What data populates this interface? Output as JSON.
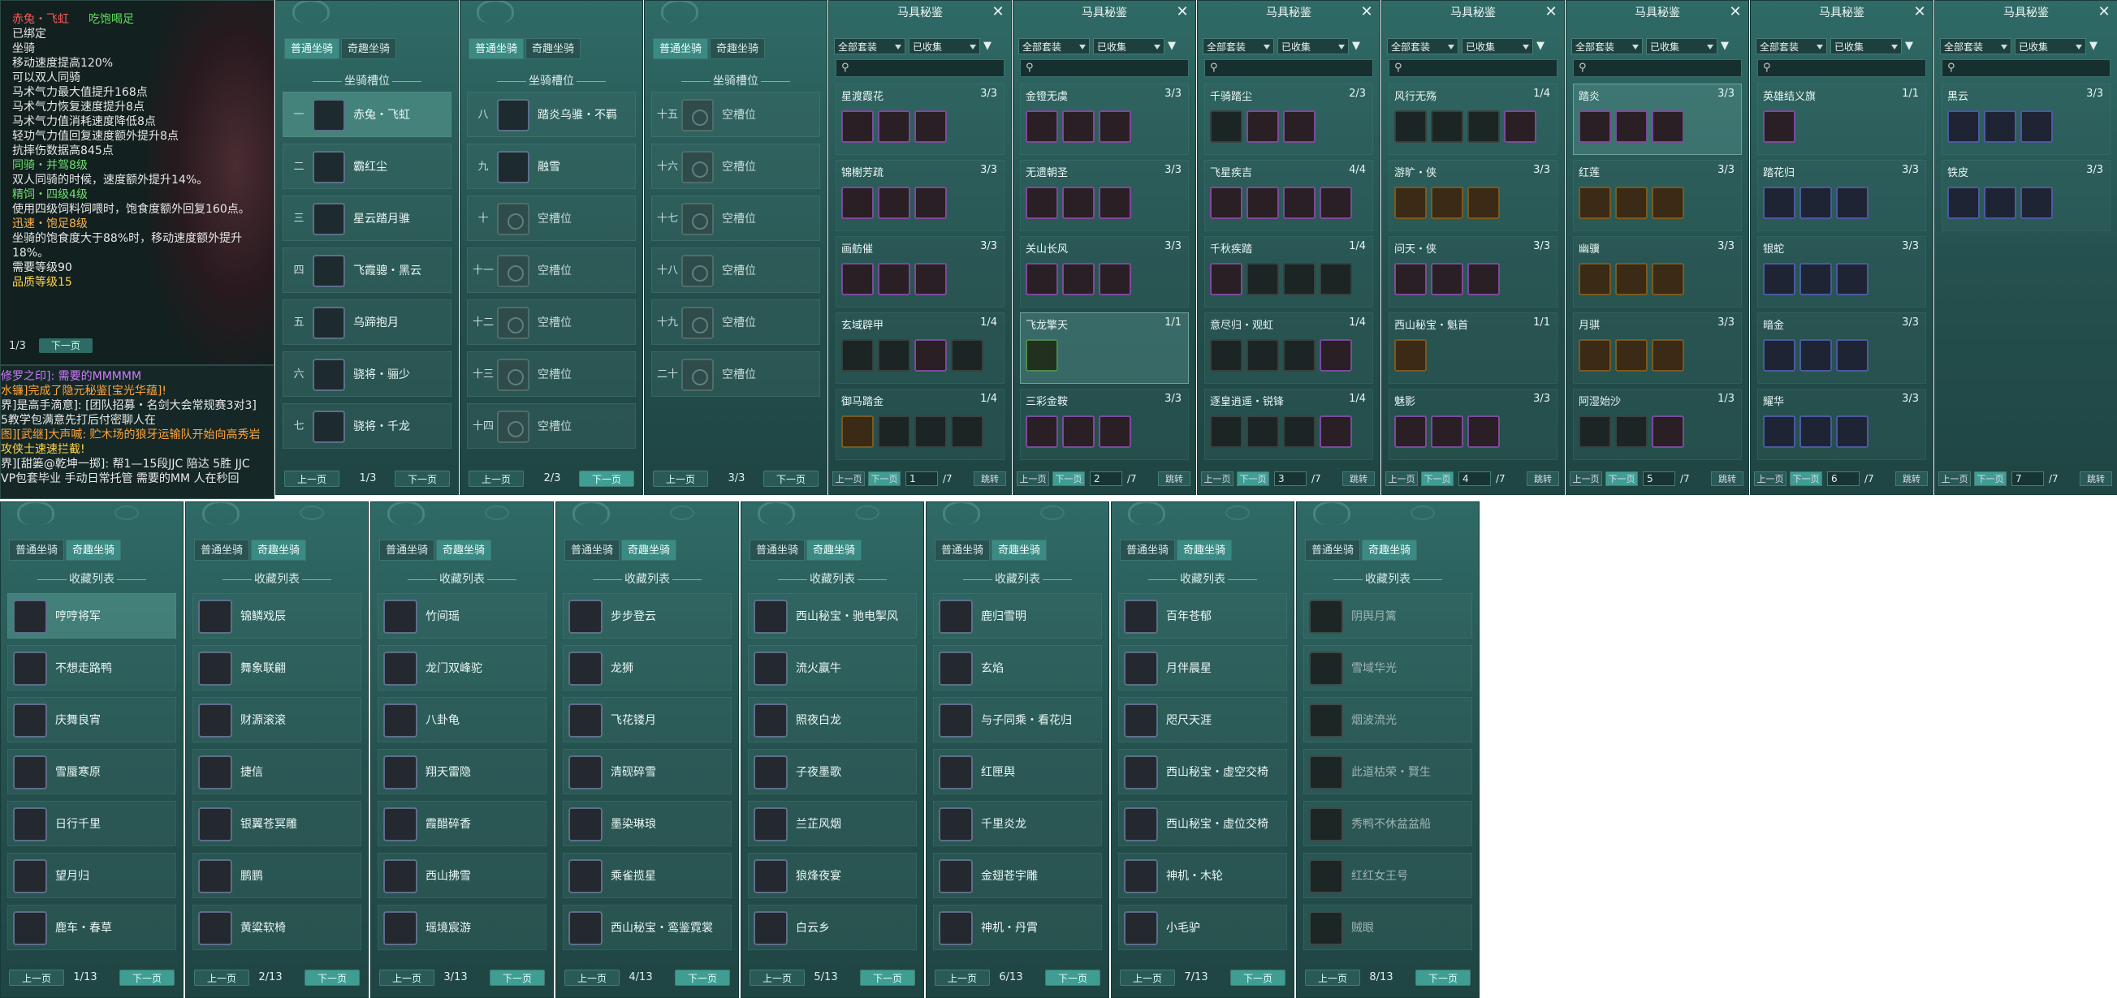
{
  "tooltip": {
    "name": "赤兔・飞虹",
    "status_tag": "吃饱喝足",
    "lines": [
      {
        "t": "已绑定",
        "c": ""
      },
      {
        "t": "坐骑",
        "c": ""
      },
      {
        "t": "移动速度提高120%",
        "c": ""
      },
      {
        "t": "可以双人同骑",
        "c": ""
      },
      {
        "t": "马术气力最大值提升168点",
        "c": ""
      },
      {
        "t": "马术气力恢复速度提升8点",
        "c": ""
      },
      {
        "t": "马术气力值消耗速度降低8点",
        "c": ""
      },
      {
        "t": "轻功气力值回复速度额外提升8点",
        "c": ""
      },
      {
        "t": "抗摔伤数据高845点",
        "c": ""
      },
      {
        "t": "同骑・并驾8级",
        "c": "skill"
      },
      {
        "t": "双人同骑的时候，速度额外提升14%。",
        "c": "desc"
      },
      {
        "t": "精饲・四级4级",
        "c": "skill"
      },
      {
        "t": "使用四级饲料饲喂时，饱食度额外回复160点。",
        "c": "desc"
      },
      {
        "t": "迅速・饱足8级",
        "c": "skill2"
      },
      {
        "t": "坐骑的饱食度大于88%时，移动速度额外提升18%。",
        "c": "desc"
      },
      {
        "t": "需要等级90",
        "c": ""
      },
      {
        "t": "品质等级15",
        "c": "q"
      }
    ],
    "page": "1/3",
    "next": "下一页"
  },
  "chat": [
    {
      "t": "修罗之印]: 需要的MMMMM",
      "c": "c-purple"
    },
    {
      "t": "水镰]完成了隐元秘鉴[宝光华蕴]!",
      "c": "c-orange"
    },
    {
      "t": "界]是高手滴意]: [团队招募・名剑大会常规赛3对3]",
      "c": "c-white"
    },
    {
      "t": "5教学包满意先打后付密聊人在",
      "c": "c-white"
    },
    {
      "t": "图][武继]大声喊: 贮木场的狼牙运输队开始向高秀岩",
      "c": "c-orange"
    },
    {
      "t": "攻侠士速速拦截!",
      "c": "c-yellow"
    },
    {
      "t": "界][甜篓@乾坤一掷]: 帮1—15段JJC 陪达 5胜 JJC",
      "c": "c-white"
    },
    {
      "t": "VP包套毕业 手动日常托管 需要的MM 人在秒回",
      "c": "c-white"
    }
  ],
  "seat_tabs": [
    "普通坐骑",
    "奇趣坐骑"
  ],
  "seat_section": "坐骑槽位",
  "seat_panels": [
    {
      "page": "1/3",
      "rows": [
        {
          "n": "一",
          "name": "赤兔・飞虹",
          "empty": false,
          "sel": true
        },
        {
          "n": "二",
          "name": "霸红尘",
          "empty": false
        },
        {
          "n": "三",
          "name": "星云踏月骓",
          "empty": false
        },
        {
          "n": "四",
          "name": "飞霞骢・黑云",
          "empty": false
        },
        {
          "n": "五",
          "name": "乌蹄抱月",
          "empty": false
        },
        {
          "n": "六",
          "name": "骁将・骊少",
          "empty": false
        },
        {
          "n": "七",
          "name": "骁将・千龙",
          "empty": false
        }
      ]
    },
    {
      "page": "2/3",
      "rows": [
        {
          "n": "八",
          "name": "踏炎乌骓・不羁",
          "empty": false
        },
        {
          "n": "九",
          "name": "融雪",
          "empty": false
        },
        {
          "n": "十",
          "name": "空槽位",
          "empty": true
        },
        {
          "n": "十一",
          "name": "空槽位",
          "empty": true
        },
        {
          "n": "十二",
          "name": "空槽位",
          "empty": true
        },
        {
          "n": "十三",
          "name": "空槽位",
          "empty": true
        },
        {
          "n": "十四",
          "name": "空槽位",
          "empty": true
        }
      ]
    },
    {
      "page": "3/3",
      "rows": [
        {
          "n": "十五",
          "name": "空槽位",
          "empty": true
        },
        {
          "n": "十六",
          "name": "空槽位",
          "empty": true
        },
        {
          "n": "十七",
          "name": "空槽位",
          "empty": true
        },
        {
          "n": "十八",
          "name": "空槽位",
          "empty": true
        },
        {
          "n": "十九",
          "name": "空槽位",
          "empty": true
        },
        {
          "n": "二十",
          "name": "空槽位",
          "empty": true
        }
      ]
    }
  ],
  "prev": "上一页",
  "next": "下一页",
  "saddle_title": "马具秘鉴",
  "saddle_filter1": "全部套装",
  "saddle_filter2": "已收集",
  "saddle_jump": "跳转",
  "saddle_total": "/7",
  "saddle_panels": [
    {
      "page": "1",
      "groups": [
        {
          "name": "星渡霞花",
          "cnt": "3/3",
          "icons": [
            "p",
            "p",
            "p"
          ]
        },
        {
          "name": "锦榭芳疏",
          "cnt": "3/3",
          "icons": [
            "p",
            "p",
            "p"
          ]
        },
        {
          "name": "画舫催",
          "cnt": "3/3",
          "icons": [
            "p",
            "p",
            "p"
          ]
        },
        {
          "name": "玄域辟甲",
          "cnt": "1/4",
          "icons": [
            "d",
            "d",
            "p",
            "d"
          ]
        },
        {
          "name": "御马踏金",
          "cnt": "1/4",
          "icons": [
            "g",
            "d",
            "d",
            "d"
          ]
        }
      ]
    },
    {
      "page": "2",
      "groups": [
        {
          "name": "金镫无虞",
          "cnt": "3/3",
          "icons": [
            "p",
            "p",
            "p"
          ]
        },
        {
          "name": "无遗朝圣",
          "cnt": "3/3",
          "icons": [
            "p",
            "p",
            "p"
          ]
        },
        {
          "name": "关山长风",
          "cnt": "3/3",
          "icons": [
            "p",
            "p",
            "p"
          ]
        },
        {
          "name": "飞龙擎天",
          "cnt": "1/1",
          "icons": [
            "gr"
          ],
          "sel": true
        },
        {
          "name": "三彩金鞍",
          "cnt": "3/3",
          "icons": [
            "p",
            "p",
            "p"
          ]
        }
      ]
    },
    {
      "page": "3",
      "groups": [
        {
          "name": "千骑踏尘",
          "cnt": "2/3",
          "icons": [
            "d",
            "p",
            "p"
          ]
        },
        {
          "name": "飞星疾吉",
          "cnt": "4/4",
          "icons": [
            "p",
            "p",
            "p",
            "p"
          ]
        },
        {
          "name": "千秋疾踏",
          "cnt": "1/4",
          "icons": [
            "p",
            "d",
            "d",
            "d"
          ]
        },
        {
          "name": "意尽归・观虹",
          "cnt": "1/4",
          "icons": [
            "d",
            "d",
            "d",
            "p"
          ]
        },
        {
          "name": "逐皇逍遥・锐锋",
          "cnt": "1/4",
          "icons": [
            "d",
            "d",
            "d",
            "p"
          ]
        }
      ]
    },
    {
      "page": "4",
      "groups": [
        {
          "name": "风行无殇",
          "cnt": "1/4",
          "icons": [
            "d",
            "d",
            "d",
            "p"
          ]
        },
        {
          "name": "游旷・侠",
          "cnt": "3/3",
          "icons": [
            "g",
            "g",
            "g"
          ]
        },
        {
          "name": "问天・侠",
          "cnt": "3/3",
          "icons": [
            "p",
            "p",
            "p"
          ]
        },
        {
          "name": "西山秘宝・魁首",
          "cnt": "1/1",
          "icons": [
            "g"
          ]
        },
        {
          "name": "魅影",
          "cnt": "3/3",
          "icons": [
            "p",
            "p",
            "p"
          ]
        }
      ]
    },
    {
      "page": "5",
      "groups": [
        {
          "name": "踏炎",
          "cnt": "3/3",
          "icons": [
            "p",
            "p",
            "p"
          ],
          "sel": true
        },
        {
          "name": "红莲",
          "cnt": "3/3",
          "icons": [
            "g",
            "g",
            "g"
          ]
        },
        {
          "name": "幽骥",
          "cnt": "3/3",
          "icons": [
            "g",
            "g",
            "g"
          ]
        },
        {
          "name": "月骐",
          "cnt": "3/3",
          "icons": [
            "g",
            "g",
            "g"
          ]
        },
        {
          "name": "阿湿始沙",
          "cnt": "1/3",
          "icons": [
            "d",
            "d",
            "p"
          ]
        }
      ]
    },
    {
      "page": "6",
      "groups": [
        {
          "name": "英雄结义旗",
          "cnt": "1/1",
          "icons": [
            "p"
          ]
        },
        {
          "name": "踏花归",
          "cnt": "3/3",
          "icons": [
            "b",
            "b",
            "b"
          ]
        },
        {
          "name": "银蛇",
          "cnt": "3/3",
          "icons": [
            "b",
            "b",
            "b"
          ]
        },
        {
          "name": "暗金",
          "cnt": "3/3",
          "icons": [
            "b",
            "b",
            "b"
          ]
        },
        {
          "name": "耀华",
          "cnt": "3/3",
          "icons": [
            "b",
            "b",
            "b"
          ]
        }
      ]
    },
    {
      "page": "7",
      "groups": [
        {
          "name": "黑云",
          "cnt": "3/3",
          "icons": [
            "b",
            "b",
            "b"
          ]
        },
        {
          "name": "铁皮",
          "cnt": "3/3",
          "icons": [
            "b",
            "b",
            "b"
          ]
        }
      ]
    }
  ],
  "fun_section": "收藏列表",
  "fun_panels": [
    {
      "page": "1/13",
      "items": [
        {
          "name": "哼哼将军",
          "sel": true
        },
        {
          "name": "不想走路鸭"
        },
        {
          "name": "庆舞良宵"
        },
        {
          "name": "雪蜃寒原"
        },
        {
          "name": "日行千里"
        },
        {
          "name": "望月归"
        },
        {
          "name": "鹿车・春草"
        }
      ]
    },
    {
      "page": "2/13",
      "items": [
        {
          "name": "锦鳞戏辰"
        },
        {
          "name": "舞象联翩"
        },
        {
          "name": "财源滚滚"
        },
        {
          "name": "捷信"
        },
        {
          "name": "银翼苍冥雕"
        },
        {
          "name": "鹏鹏"
        },
        {
          "name": "黄粱软椅"
        }
      ]
    },
    {
      "page": "3/13",
      "items": [
        {
          "name": "竹间瑶"
        },
        {
          "name": "龙门双峰驼"
        },
        {
          "name": "八卦龟"
        },
        {
          "name": "翔天雷隐"
        },
        {
          "name": "霞醋碎香"
        },
        {
          "name": "西山拂雪"
        },
        {
          "name": "瑶境宸游"
        }
      ]
    },
    {
      "page": "4/13",
      "items": [
        {
          "name": "步步登云"
        },
        {
          "name": "龙狮"
        },
        {
          "name": "飞花镂月"
        },
        {
          "name": "清砚碎雪"
        },
        {
          "name": "墨染琳琅"
        },
        {
          "name": "乘雀揽星"
        },
        {
          "name": "西山秘宝・鸾鉴霓裳"
        }
      ]
    },
    {
      "page": "5/13",
      "items": [
        {
          "name": "西山秘宝・驰电掣风"
        },
        {
          "name": "流火赢牛"
        },
        {
          "name": "照夜白龙"
        },
        {
          "name": "子夜墨歌"
        },
        {
          "name": "兰芷风烟"
        },
        {
          "name": "狼烽夜宴"
        },
        {
          "name": "白云乡"
        }
      ]
    },
    {
      "page": "6/13",
      "items": [
        {
          "name": "鹿归雪明"
        },
        {
          "name": "玄焰"
        },
        {
          "name": "与子同乘・看花归"
        },
        {
          "name": "红匣舆"
        },
        {
          "name": "千里炎龙"
        },
        {
          "name": "金翅苍宇雕"
        },
        {
          "name": "神机・丹霄"
        }
      ]
    },
    {
      "page": "7/13",
      "items": [
        {
          "name": "百年苍郁"
        },
        {
          "name": "月伴晨星"
        },
        {
          "name": "咫尺天涯"
        },
        {
          "name": "西山秘宝・虚空交椅"
        },
        {
          "name": "西山秘宝・虚位交椅"
        },
        {
          "name": "神机・木轮"
        },
        {
          "name": "小毛驴"
        }
      ]
    },
    {
      "page": "8/13",
      "items": [
        {
          "name": "阴舆月篱",
          "dim": true
        },
        {
          "name": "雪域华光",
          "dim": true
        },
        {
          "name": "烟波流光",
          "dim": true
        },
        {
          "name": "此道枯荣・賢生",
          "dim": true
        },
        {
          "name": "秀鸭不休盆盆船",
          "dim": true
        },
        {
          "name": "红红女王号",
          "dim": true
        },
        {
          "name": "贼眼",
          "dim": true
        }
      ]
    }
  ]
}
